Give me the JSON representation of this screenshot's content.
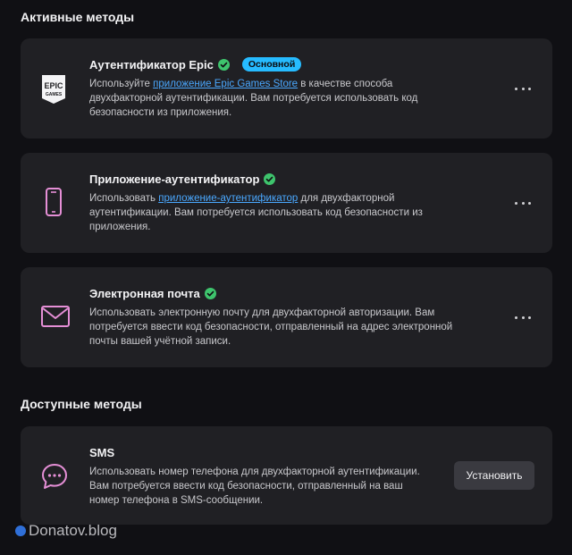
{
  "active_section": {
    "title": "Активные методы"
  },
  "available_section": {
    "title": "Доступные методы"
  },
  "methods": [
    {
      "title": "Аутентификатор Epic",
      "badge": "Основной",
      "desc_before": "Используйте ",
      "desc_link": "приложение Epic Games Store",
      "desc_after": " в качестве способа двухфакторной аутентификации. Вам потребуется использовать код безопасности из приложения.",
      "icon_label_top": "EPIC",
      "icon_label_bottom": "GAMES"
    },
    {
      "title": "Приложение-аутентификатор",
      "desc_before": "Использовать ",
      "desc_link": "приложение-аутентификатор",
      "desc_after": " для двухфакторной аутентификации. Вам потребуется использовать код безопасности из приложения."
    },
    {
      "title": "Электронная почта",
      "desc": "Использовать электронную почту для двухфакторной авторизации. Вам потребуется ввести код безопасности, отправленный на адрес электронной почты вашей учётной записи."
    }
  ],
  "available": [
    {
      "title": "SMS",
      "desc": "Использовать номер телефона для двухфакторной аутентификации. Вам потребуется ввести код безопасности, отправленный на ваш номер телефона в SMS-сообщении.",
      "button": "Установить"
    }
  ],
  "watermark": "Donatov.blog",
  "colors": {
    "accent": "#26bbff",
    "link": "#4aa8ff",
    "check": "#3ec46d",
    "icon_pink": "#e58fd6",
    "card_bg": "#202024",
    "page_bg": "#101014"
  }
}
